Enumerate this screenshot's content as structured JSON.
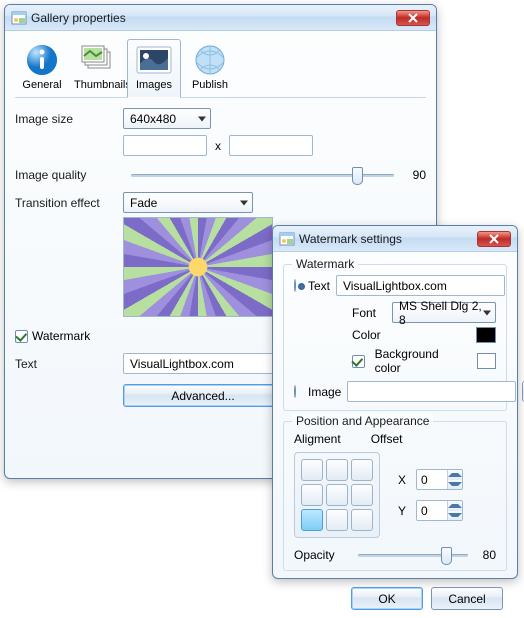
{
  "gallery": {
    "title": "Gallery properties",
    "tabs": {
      "general": "General",
      "thumbnails": "Thumbnails",
      "images": "Images",
      "publish": "Publish"
    },
    "labels": {
      "image_size": "Image size",
      "image_quality": "Image quality",
      "transition_effect": "Transition effect",
      "watermark": "Watermark",
      "text": "Text"
    },
    "image_size": {
      "selected": "640x480",
      "width": "",
      "height": "",
      "x": "x"
    },
    "image_quality": {
      "value": "90",
      "pos_pct": 86
    },
    "transition_effect": {
      "selected": "Fade"
    },
    "watermark_checked": true,
    "watermark_text": "VisualLightbox.com",
    "advanced_label": "Advanced..."
  },
  "watermark": {
    "title": "Watermark settings",
    "group_watermark": "Watermark",
    "radio_text": "Text",
    "radio_image": "Image",
    "text_value": "VisualLightbox.com",
    "font_label": "Font",
    "font_value": "MS Shell Dlg 2, 8",
    "color_label": "Color",
    "color_value": "#000000",
    "bg_color_label": "Background color",
    "bg_color_checked": true,
    "bg_color_value": "#ffffff",
    "image_value": "",
    "browse": "...",
    "group_position": "Position and Appearance",
    "alignment_label": "Aligment",
    "offset_label": "Offset",
    "offset_x_label": "X",
    "offset_y_label": "Y",
    "offset_x": "0",
    "offset_y": "0",
    "alignment_index": 6,
    "opacity_label": "Opacity",
    "opacity_value": "80",
    "opacity_pos_pct": 80,
    "ok": "OK",
    "cancel": "Cancel"
  }
}
